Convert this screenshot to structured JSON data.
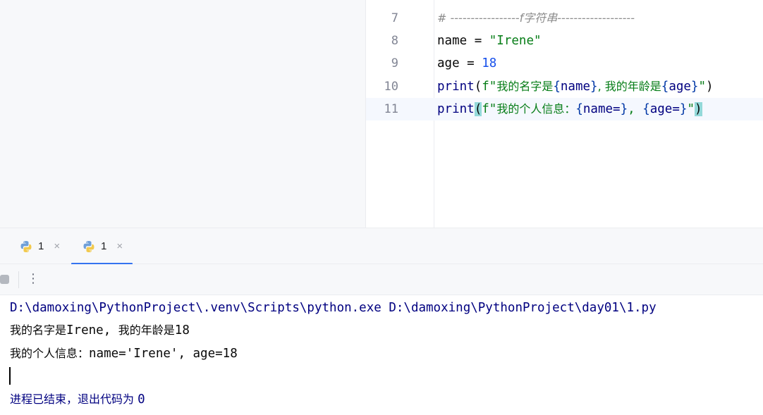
{
  "editor": {
    "lines": [
      {
        "num": "7",
        "comment": "# -----------------f字符串-------------------"
      },
      {
        "num": "8",
        "name": "name",
        "eq": " = ",
        "str": "\"Irene\""
      },
      {
        "num": "9",
        "name": "age",
        "eq": " = ",
        "value": "18"
      },
      {
        "num": "10",
        "fn": "print",
        "open": "(",
        "prefix": "f\"",
        "t1": "我的名字是",
        "b1o": "{",
        "v1": "name",
        "b1c": "}",
        "t2": ", 我的年龄是",
        "b2o": "{",
        "v2": "age",
        "b2c": "}",
        "end": "\"",
        "close": ")"
      },
      {
        "num": "11",
        "fn": "print",
        "open": "(",
        "prefix": "f\"",
        "t1": "我的个人信息：",
        "b1o": "{",
        "v1": "name=",
        "b1c": "}",
        "t2": ", ",
        "b2o": "{",
        "v2": "age=",
        "b2c": "}",
        "end": "\"",
        "close": ")"
      }
    ]
  },
  "tabs": [
    {
      "label": "1",
      "close": "×",
      "active": false
    },
    {
      "label": "1",
      "close": "×",
      "active": true
    }
  ],
  "toolbar": {
    "more": "⋮"
  },
  "console": {
    "command": "D:\\damoxing\\PythonProject\\.venv\\Scripts\\python.exe D:\\damoxing\\PythonProject\\day01\\1.py",
    "output1_a": "我的名字是",
    "output1_b": "Irene, ",
    "output1_c": "我的年龄是",
    "output1_d": "18",
    "output2_a": "我的个人信息：",
    "output2_b": "name='Irene', age=18",
    "exit_text": "进程已结束，退出代码为 ",
    "exit_code": "0"
  }
}
